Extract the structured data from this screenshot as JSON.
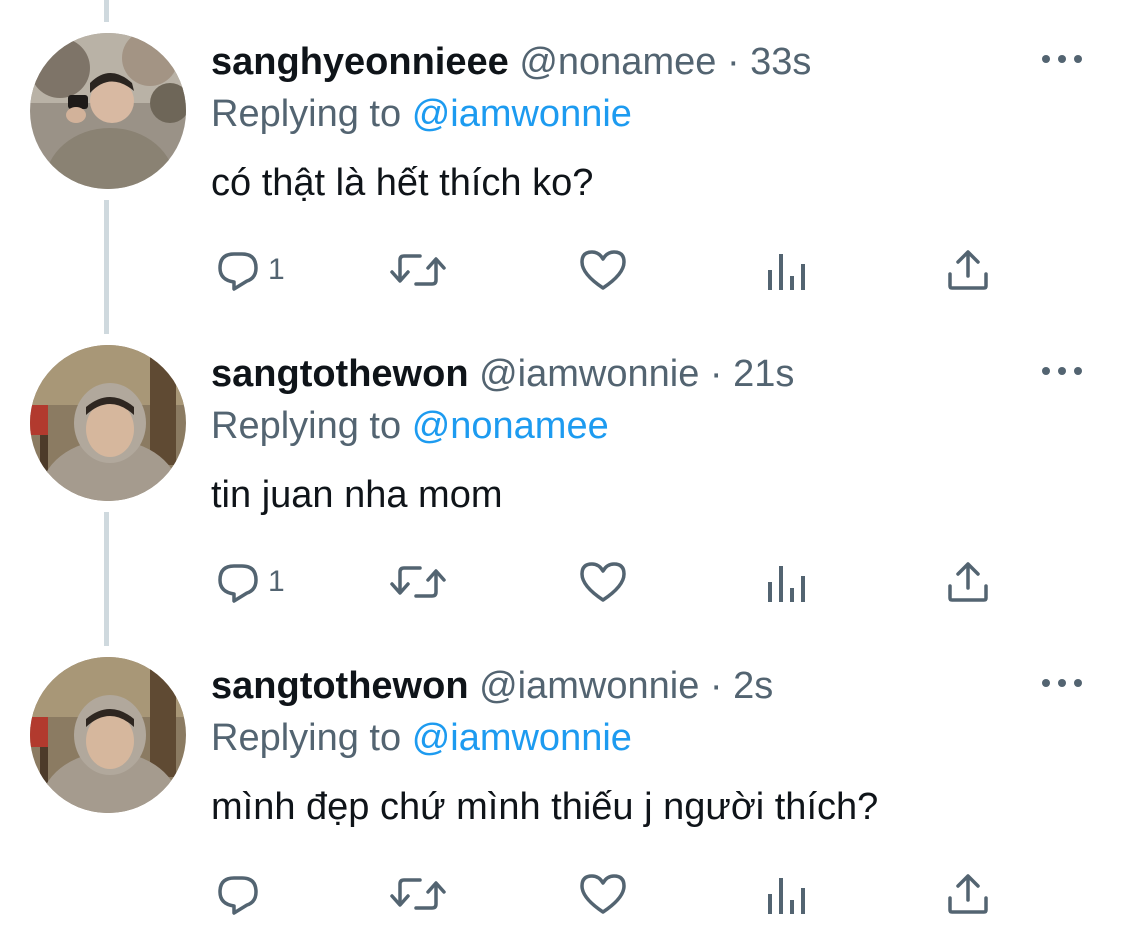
{
  "colors": {
    "text": "#0f1419",
    "secondary": "#536471",
    "accent": "#1d9bf0",
    "thread_line": "#cfd9de"
  },
  "tweets": [
    {
      "display_name": "sanghyeonnieee",
      "handle": "@nonamee",
      "separator": "·",
      "time": "33s",
      "replying_prefix": "Replying to",
      "replying_to": "@iamwonnie",
      "text": "có thật là hết thích ko?",
      "reply_count": "1",
      "avatar": "avatar-photo-1"
    },
    {
      "display_name": "sangtothewon",
      "handle": "@iamwonnie",
      "separator": "·",
      "time": "21s",
      "replying_prefix": "Replying to",
      "replying_to": "@nonamee",
      "text": "tin juan nha mom",
      "reply_count": "1",
      "avatar": "avatar-photo-2"
    },
    {
      "display_name": "sangtothewon",
      "handle": "@iamwonnie",
      "separator": "·",
      "time": "2s",
      "replying_prefix": "Replying to",
      "replying_to": "@iamwonnie",
      "text": "mình đẹp chứ mình thiếu j người thích?",
      "reply_count": "",
      "avatar": "avatar-photo-2"
    }
  ],
  "icons": [
    "reply-icon",
    "retweet-icon",
    "like-icon",
    "analytics-icon",
    "share-icon",
    "more-options-icon"
  ]
}
